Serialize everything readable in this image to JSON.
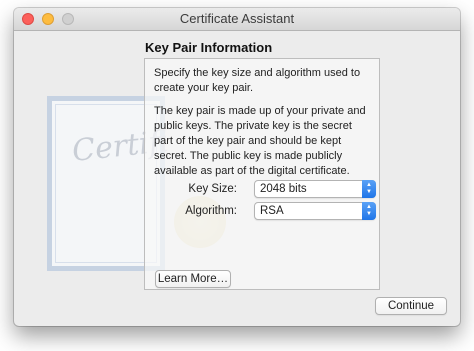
{
  "window": {
    "title": "Certificate Assistant"
  },
  "background": {
    "certificate_script": "Certifi"
  },
  "section": {
    "heading": "Key Pair Information"
  },
  "panel": {
    "paragraph1": "Specify the key size and algorithm used to create your key pair.",
    "paragraph2": "The key pair is made up of your private and public keys. The private key is the secret part of the key pair and should be kept secret. The public key is made publicly available as part of the digital certificate."
  },
  "form": {
    "key_size_label": "Key Size:",
    "key_size_value": "2048 bits",
    "algorithm_label": "Algorithm:",
    "algorithm_value": "RSA"
  },
  "buttons": {
    "learn_more": "Learn More…",
    "continue": "Continue"
  },
  "colors": {
    "close": "#fc605b",
    "minimize": "#fdbc40",
    "zoom": "#d0d0d0",
    "popup_accent": "#1f75e8"
  },
  "icons": {
    "popup_arrows": "up-down-chevron-icon",
    "seal": "certificate-seal-icon"
  }
}
